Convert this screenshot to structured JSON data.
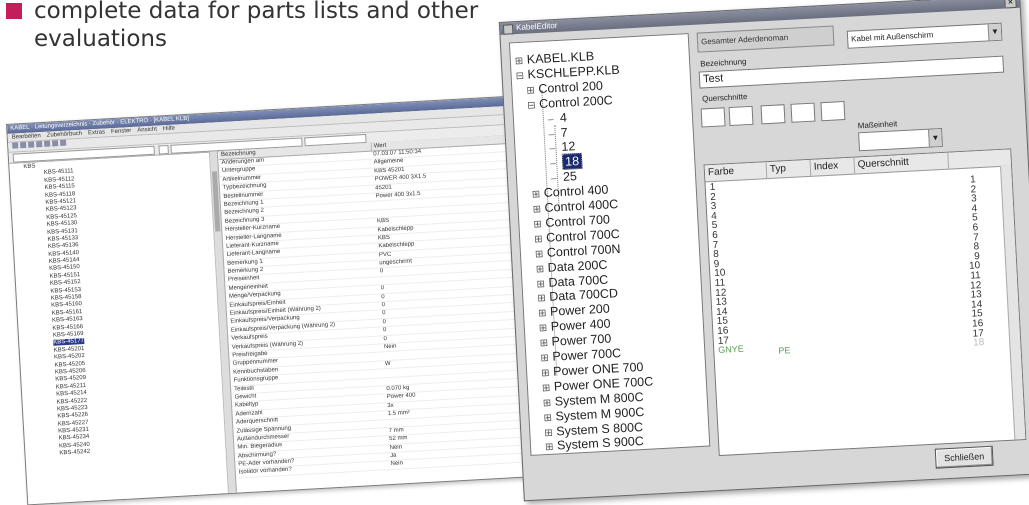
{
  "caption": {
    "line1": "complete data for parts lists and other",
    "line2": "evaluations"
  },
  "back_window": {
    "title": "KABEL · Leitungsverzeichnis · Zubehör · ELEKTRO · [KABEL KLB]",
    "menu": [
      "Bearbeiten",
      "Zubehörbuch",
      "Extras",
      "Fenster",
      "Ansicht",
      "Hilfe"
    ],
    "tree_root": "KBS",
    "tree_items": [
      "KBS-45111",
      "KBS-45112",
      "KBS-45115",
      "KBS-45118",
      "KBS-45121",
      "KBS-45123",
      "KBS-45125",
      "KBS-45130",
      "KBS-45131",
      "KBS-45133",
      "KBS-45136",
      "KBS-45140",
      "KBS-45144",
      "KBS-45150",
      "KBS-45151",
      "KBS-45152",
      "KBS-45153",
      "KBS-45158",
      "KBS-45160",
      "KBS-45161",
      "KBS-45163",
      "KBS-45166",
      "KBS-45169",
      "KBS-45177",
      "KBS-45201",
      "KBS-45202",
      "KBS-45205",
      "KBS-45206",
      "KBS-45209",
      "KBS-45211",
      "KBS-45214",
      "KBS-45222",
      "KBS-45223",
      "KBS-45226",
      "KBS-45227",
      "KBS-45231",
      "KBS-45234",
      "KBS-45240",
      "KBS-45242"
    ],
    "tree_selected_index": 23,
    "columns": [
      "Bezeichnung",
      "Wert"
    ],
    "rows": [
      [
        "Änderungen am",
        "07.03.07 11:50:34"
      ],
      [
        "Untergruppe",
        "Allgemeine"
      ],
      [
        "Artikelnummer",
        "KBS 45201"
      ],
      [
        "Typbezeichnung",
        "POWER 400 3X1.5"
      ],
      [
        "Bestellnummer",
        "45201"
      ],
      [
        "Bezeichnung 1",
        "Power 400 3x1.5"
      ],
      [
        "Bezeichnung 2",
        ""
      ],
      [
        "Bezeichnung 3",
        ""
      ],
      [
        "Hersteller-Kurzname",
        "KBS"
      ],
      [
        "Hersteller-Langname",
        "Kabelschlepp"
      ],
      [
        "Lieferant-Kurzname",
        "KBS"
      ],
      [
        "Lieferant-Langname",
        "Kabelschlepp"
      ],
      [
        "Bemerkung 1",
        "PVC"
      ],
      [
        "Bemerkung 2",
        "ungeschirmt"
      ],
      [
        "Preiseinheit",
        "0"
      ],
      [
        "Mengeneinheit",
        ""
      ],
      [
        "Menge/Verpackung",
        "0"
      ],
      [
        "Einkaufspreis/Einheit",
        "0"
      ],
      [
        "Einkaufspreis/Einheit (Währung 2)",
        "0"
      ],
      [
        "Einkaufspreis/Verpackung",
        "0"
      ],
      [
        "Einkaufspreis/Verpackung (Währung 2)",
        "0"
      ],
      [
        "Verkaufspreis",
        "0"
      ],
      [
        "Verkaufspreis (Währung 2)",
        "0"
      ],
      [
        "Preisfreigabe",
        "Nein"
      ],
      [
        "Gruppennummer",
        ""
      ],
      [
        "Kennbuchstaben",
        "W"
      ],
      [
        "Funktionsgruppe",
        ""
      ],
      [
        "Teilestil",
        ""
      ],
      [
        "Gewicht",
        "0.070 kg"
      ],
      [
        "Kabeltyp",
        "Power 400"
      ],
      [
        "Adernzahl",
        "3x"
      ],
      [
        "Aderquerschnitt",
        "1.5 mm²"
      ],
      [
        "Zulässige Spannung",
        ""
      ],
      [
        "Außendurchmesser",
        "7 mm"
      ],
      [
        "Min. Biegeradius",
        "52 mm"
      ],
      [
        "Abschirmung?",
        "Nein"
      ],
      [
        "PE-Ader vorhanden?",
        "Ja"
      ],
      [
        "Isolator vorhanden?",
        "Nein"
      ]
    ]
  },
  "dialog": {
    "title": "KabelEditor",
    "tree": [
      {
        "label": "KABEL.KLB",
        "exp": "+",
        "level": 0
      },
      {
        "label": "KSCHLEPP.KLB",
        "exp": "−",
        "level": 0
      },
      {
        "label": "Control 200",
        "exp": "+",
        "level": 1
      },
      {
        "label": "Control 200C",
        "exp": "−",
        "level": 1
      },
      {
        "label": "4",
        "exp": "",
        "level": 2
      },
      {
        "label": "7",
        "exp": "",
        "level": 2
      },
      {
        "label": "12",
        "exp": "",
        "level": 2
      },
      {
        "label": "18",
        "exp": "",
        "level": 2,
        "selected": true
      },
      {
        "label": "25",
        "exp": "",
        "level": 2
      },
      {
        "label": "Control 400",
        "exp": "+",
        "level": 1
      },
      {
        "label": "Control 400C",
        "exp": "+",
        "level": 1
      },
      {
        "label": "Control 700",
        "exp": "+",
        "level": 1
      },
      {
        "label": "Control 700C",
        "exp": "+",
        "level": 1
      },
      {
        "label": "Control 700N",
        "exp": "+",
        "level": 1
      },
      {
        "label": "Data 200C",
        "exp": "+",
        "level": 1
      },
      {
        "label": "Data 700C",
        "exp": "+",
        "level": 1
      },
      {
        "label": "Data 700CD",
        "exp": "+",
        "level": 1
      },
      {
        "label": "Power 200",
        "exp": "+",
        "level": 1
      },
      {
        "label": "Power 400",
        "exp": "+",
        "level": 1
      },
      {
        "label": "Power 700",
        "exp": "+",
        "level": 1
      },
      {
        "label": "Power 700C",
        "exp": "+",
        "level": 1
      },
      {
        "label": "Power ONE 700",
        "exp": "+",
        "level": 1
      },
      {
        "label": "Power ONE 700C",
        "exp": "+",
        "level": 1
      },
      {
        "label": "System M 800C",
        "exp": "+",
        "level": 1
      },
      {
        "label": "System M 900C",
        "exp": "+",
        "level": 1
      },
      {
        "label": "System S 800C",
        "exp": "+",
        "level": 1
      },
      {
        "label": "System S 900C",
        "exp": "+",
        "level": 1
      }
    ],
    "cable_name_label": "Gesamter Aderdenoman",
    "cable_type_value": "Kabel mit Außenschirm",
    "designation_label": "Bezeichnung",
    "designation_value": "Test",
    "cross_section_label": "Querschnitte",
    "unit_label": "Maßeinheit",
    "unit_value": "",
    "table_headers": [
      "Farbe",
      "Typ",
      "Index",
      "Querschnitt"
    ],
    "left_numbers": [
      "1",
      "2",
      "3",
      "4",
      "5",
      "6",
      "7",
      "8",
      "9",
      "10",
      "11",
      "12",
      "13",
      "14",
      "15",
      "16",
      "17"
    ],
    "right_numbers": [
      "1",
      "2",
      "3",
      "4",
      "5",
      "6",
      "7",
      "8",
      "9",
      "10",
      "11",
      "12",
      "13",
      "14",
      "15",
      "16",
      "17",
      "18"
    ],
    "green_row": {
      "farbe": "GNYE",
      "typ": "PE"
    },
    "close_label": "Schließen"
  },
  "colors": {
    "accent": "#c41d5a",
    "selection": "#1c2a6e",
    "green_text": "#5aa05a"
  }
}
